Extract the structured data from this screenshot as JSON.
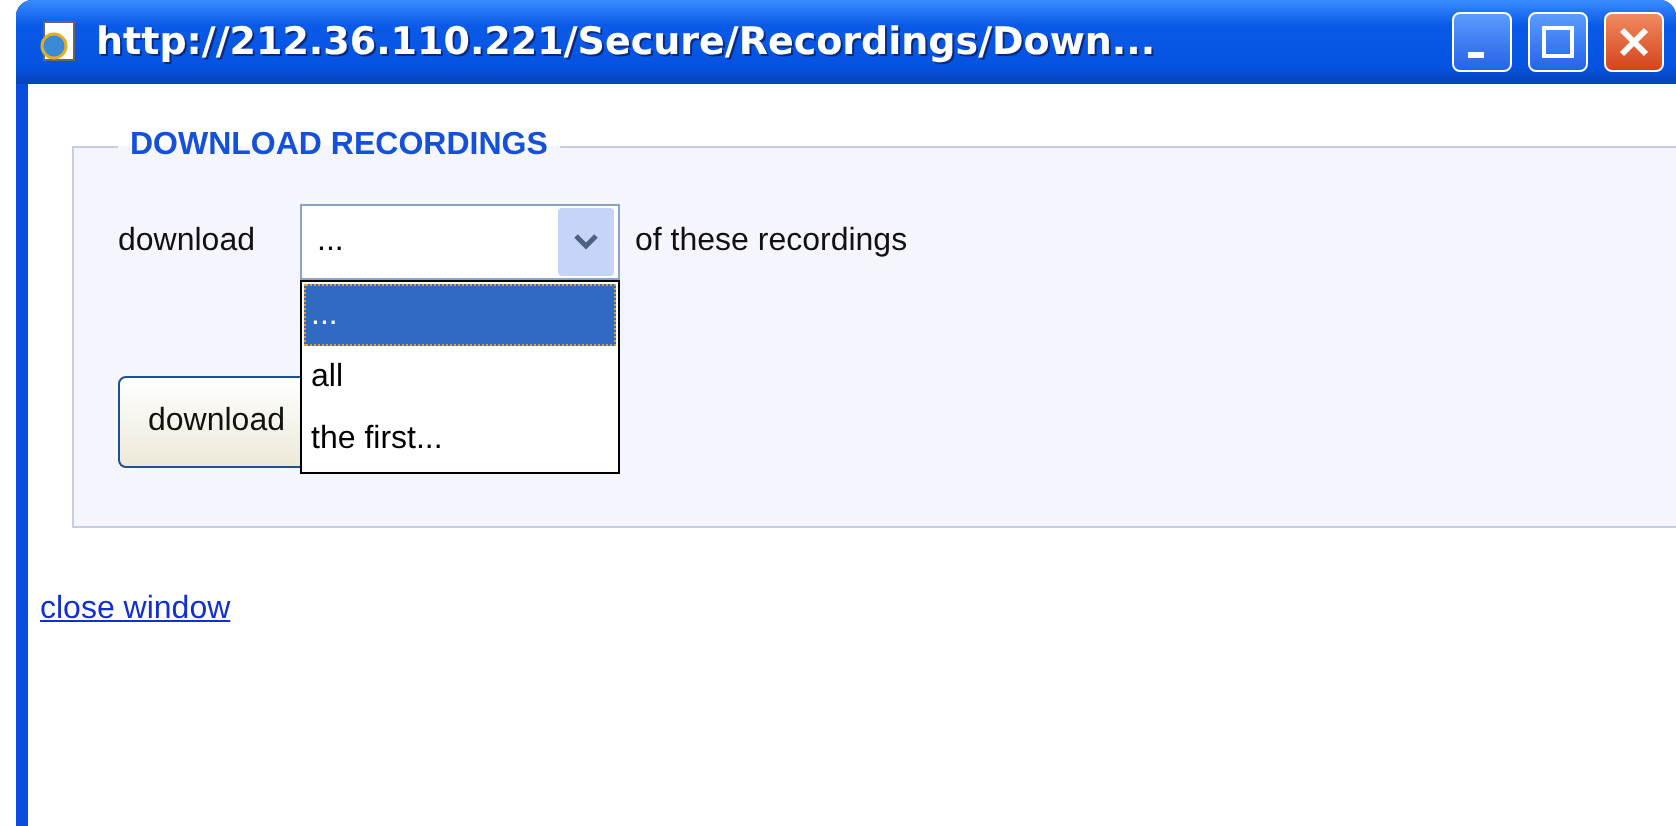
{
  "window": {
    "title": "http://212.36.110.221/Secure/Recordings/Down..."
  },
  "section": {
    "legend": "DOWNLOAD RECORDINGS",
    "label": "download",
    "select": {
      "value": "...",
      "expanded": true,
      "options": [
        {
          "label": "...",
          "selected": true
        },
        {
          "label": "all",
          "selected": false
        },
        {
          "label": "the first...",
          "selected": false
        }
      ]
    },
    "suffix": "of these recordings",
    "button": "download"
  },
  "link": "close window"
}
